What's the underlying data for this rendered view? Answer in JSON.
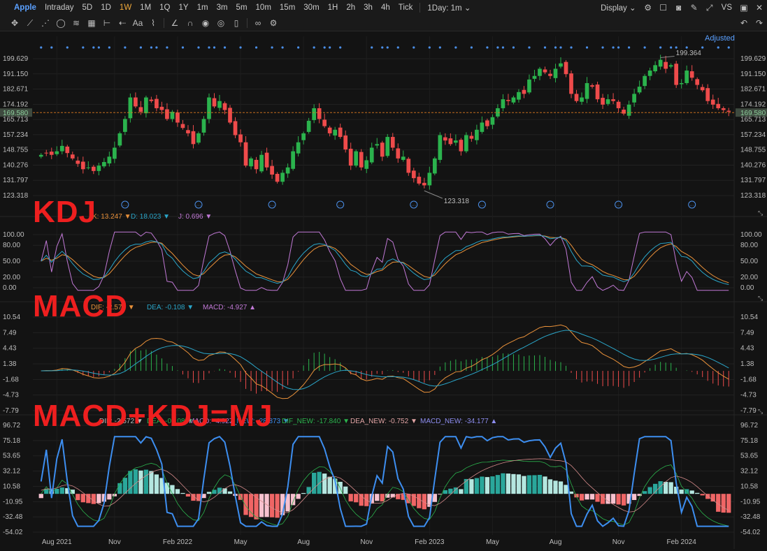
{
  "toolbar": {
    "symbol": "Apple",
    "timeframes": [
      "Intraday",
      "5D",
      "1D",
      "1W",
      "1M",
      "1Q",
      "1Y",
      "1m",
      "3m",
      "5m",
      "10m",
      "15m",
      "30m",
      "1H",
      "2h",
      "3h",
      "4h",
      "Tick"
    ],
    "active_timeframe": "1W",
    "interval_select": "1Day: 1m",
    "display_label": "Display",
    "vs_label": "VS",
    "adjusted_label": "Adjusted"
  },
  "overlays": {
    "kdj_big": "KDJ",
    "macd_big": "MACD",
    "mj_big": "MACD+KDJ=MJ"
  },
  "colors": {
    "bg": "#131313",
    "up": "#2bb34d",
    "down": "#ee4b4b",
    "overlay_red": "#ee1f1f",
    "price_line": "#e07b1e",
    "k_line": "#c179d6",
    "d_line": "#e9913a",
    "j_line": "#2aa6c9",
    "hist_teal": "#2aa79b",
    "hist_light": "#b5e7e0",
    "hist_red": "#f06565",
    "hist_pink": "#f7c2cf",
    "j_new": "#3d8ef0"
  },
  "chart_data": [
    {
      "type": "candlestick",
      "id": "price",
      "y_ticks": [
        "199.629",
        "191.150",
        "182.671",
        "174.192",
        "165.713",
        "157.234",
        "148.755",
        "140.276",
        "131.797",
        "123.318"
      ],
      "ylim": [
        123.318,
        199.629
      ],
      "current_price": "169.580",
      "annotations": {
        "high": "199.364",
        "low": "123.318"
      },
      "x_ticks": [
        "Aug 2021",
        "Nov",
        "Feb 2022",
        "May",
        "Aug",
        "Nov",
        "Feb 2023",
        "May",
        "Aug",
        "Nov",
        "Feb 2024"
      ],
      "closes": [
        146,
        147,
        146,
        148,
        151,
        147,
        144,
        141,
        138,
        139,
        137,
        140,
        142,
        145,
        150,
        158,
        166,
        178,
        173,
        170,
        178,
        176,
        172,
        171,
        166,
        170,
        164,
        161,
        158,
        152,
        158,
        166,
        178,
        173,
        176,
        171,
        164,
        157,
        153,
        140,
        144,
        138,
        146,
        139,
        135,
        131,
        136,
        139,
        148,
        153,
        158,
        165,
        172,
        166,
        162,
        158,
        160,
        156,
        149,
        140,
        148,
        139,
        143,
        150,
        152,
        145,
        156,
        150,
        144,
        145,
        136,
        133,
        130,
        129,
        136,
        144,
        157,
        154,
        152,
        154,
        148,
        157,
        155,
        160,
        164,
        162,
        167,
        172,
        177,
        176,
        178,
        181,
        180,
        188,
        190,
        194,
        192,
        190,
        194,
        197,
        191,
        180,
        176,
        178,
        186,
        184,
        177,
        174,
        177,
        176,
        172,
        169,
        174,
        180,
        184,
        190,
        193,
        196,
        199,
        194,
        196,
        185,
        186,
        193,
        189,
        185,
        182,
        176,
        174,
        172,
        171,
        170
      ]
    },
    {
      "type": "line",
      "id": "kdj",
      "legend": [
        {
          "name": "K",
          "value": "13.247",
          "arrow": "▼"
        },
        {
          "name": "D",
          "value": "18.023",
          "arrow": "▼"
        },
        {
          "name": "J",
          "value": "0.696",
          "arrow": "▼"
        }
      ],
      "legend_prefix": "KDJ",
      "y_ticks": [
        "100.00",
        "80.00",
        "50.00",
        "20.00",
        "0.00"
      ],
      "ylim": [
        0,
        100
      ]
    },
    {
      "type": "bar",
      "id": "macd",
      "legend_prefix": "MACD",
      "legend": [
        {
          "name": "DIF",
          "value": "-2.572",
          "arrow": "▼"
        },
        {
          "name": "DEA",
          "value": "-0.108",
          "arrow": "▼"
        },
        {
          "name": "MACD",
          "value": "-4.927",
          "arrow": "▲"
        }
      ],
      "y_ticks": [
        "10.54",
        "7.49",
        "4.43",
        "1.38",
        "-1.68",
        "-4.73",
        "-7.79"
      ],
      "ylim": [
        -7.79,
        10.54
      ]
    },
    {
      "type": "bar",
      "id": "mj",
      "legend": [
        {
          "name": "DIF",
          "value": "-2.572",
          "arrow": "▼"
        },
        {
          "name": "DEA",
          "value": "-0.108",
          "arrow": "▼"
        },
        {
          "name": "MACD",
          "value": "-4.927",
          "arrow": ""
        },
        {
          "name": "J_NEW",
          "value": "-28.873",
          "arrow": "▼"
        },
        {
          "name": "DIF_NEW",
          "value": "-17.840",
          "arrow": "▼"
        },
        {
          "name": "DEA_NEW",
          "value": "-0.752",
          "arrow": "▼"
        },
        {
          "name": "MACD_NEW",
          "value": "-34.177",
          "arrow": "▲"
        }
      ],
      "y_ticks": [
        "96.72",
        "75.18",
        "53.65",
        "32.12",
        "10.58",
        "-10.95",
        "-32.48",
        "-54.02"
      ],
      "ylim": [
        -54.02,
        96.72
      ]
    }
  ]
}
